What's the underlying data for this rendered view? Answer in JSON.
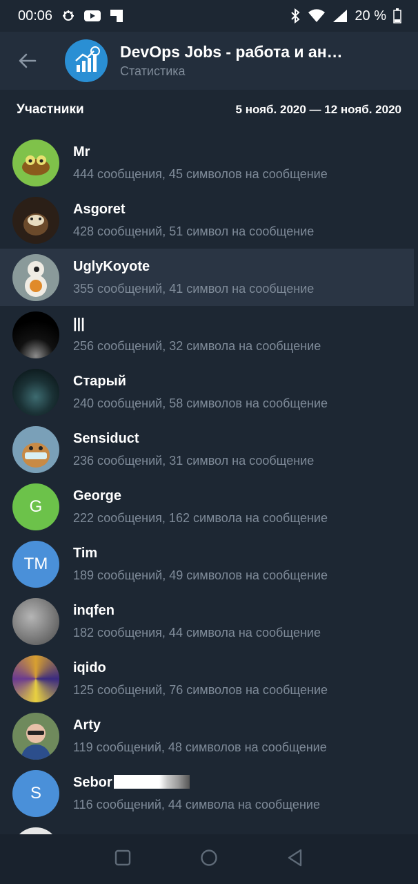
{
  "status": {
    "time": "00:06",
    "battery": "20 %"
  },
  "header": {
    "title": "DevOps Jobs - работа и ан…",
    "subtitle": "Статистика"
  },
  "section": {
    "title": "Участники",
    "date_range": "5 нояб. 2020 — 12 нояб. 2020"
  },
  "members": [
    {
      "name": "Mr",
      "stats": "444 сообщения, 45 символов на сообщение",
      "initials": "",
      "color": "#7fc24a"
    },
    {
      "name": "Asgoret",
      "stats": "428 сообщений, 51 символ на сообщение",
      "initials": "",
      "color": "#3b2a1d"
    },
    {
      "name": "UglyKoyote",
      "stats": "355 сообщений, 41 символ на сообщение",
      "initials": "",
      "color": "#8a7a63"
    },
    {
      "name": "|||",
      "stats": "256 сообщений, 32 символа на сообщение",
      "initials": "",
      "color": "#050505"
    },
    {
      "name": "Старый",
      "stats": "240 сообщений, 58 символов на сообщение",
      "initials": "",
      "color": "#1e3a3f"
    },
    {
      "name": "Sensiduct",
      "stats": "236 сообщений, 31 символ на сообщение",
      "initials": "",
      "color": "#b8864e"
    },
    {
      "name": "George",
      "stats": "222 сообщения, 162 символа на сообщение",
      "initials": "G",
      "color": "#6cc24a"
    },
    {
      "name": "Tim",
      "stats": "189 сообщений, 49 символов на сообщение",
      "initials": "TM",
      "color": "#4a90d9"
    },
    {
      "name": "inqfen",
      "stats": "182 сообщения, 44 символа на сообщение",
      "initials": "",
      "color": "#8a8a8a"
    },
    {
      "name": "iqido",
      "stats": "125 сообщений, 76 символов на сообщение",
      "initials": "",
      "color": "#b6892f"
    },
    {
      "name": "Arty",
      "stats": "119 сообщений, 48 символов на сообщение",
      "initials": "",
      "color": "#6f8a5c"
    },
    {
      "name": "Sebor",
      "stats": "116 сообщений, 44 символа на сообщение",
      "initials": "S",
      "color": "#4a90d9"
    },
    {
      "name": "",
      "stats": "",
      "initials": "",
      "color": "#e6e6e6"
    }
  ]
}
